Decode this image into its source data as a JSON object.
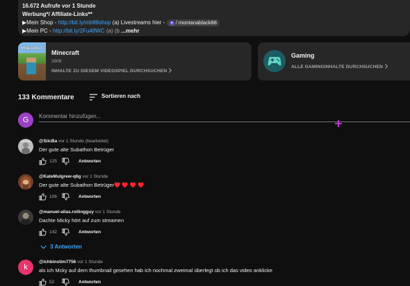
{
  "description": {
    "views_line": "16.672 Aufrufe  vor 1 Stunde",
    "affiliate_line": "Werbung*/ Affiliate-Links**",
    "shop": {
      "prefix": "▶Mein Shop - ",
      "link": "http://bit.ly/mb88shop",
      "middle": " (a) Livestreams hier - ",
      "chip_label": "/ montanablack88"
    },
    "pc": {
      "prefix": "▶Mein PC - ",
      "link": "http://bit.ly/2Fu48WC",
      "middle": " (a) (b",
      "more_label": "...mehr"
    }
  },
  "game_card": {
    "thumb_title": "MINECRAFT",
    "title": "Minecraft",
    "year": "2009",
    "cta": "INHALTE ZU DIESEM VIDEOSPIEL DURCHSUCHEN",
    "cta_icon": "chevron-right-icon"
  },
  "gaming_card": {
    "title": "Gaming",
    "cta": "ALLE GAMINGINHALTE DURCHSUCHEN",
    "icon": "gamepad-icon"
  },
  "comments": {
    "count_label": "133 Kommentare",
    "sort_label": "Sortieren nach",
    "input_placeholder": "Kommentar hinzufügen...",
    "my_avatar_letter": "G",
    "replies_toggle_label": "3 Antworten",
    "items": [
      {
        "author": "@SiicBa",
        "time": "vor 1 Stunde (bearbeitet)",
        "text": "Der gute alte Subathon Betrüger",
        "likes": "125",
        "reply_label": "Antworten"
      },
      {
        "author": "@KateMulgrew-q6g",
        "time": "vor 1 Stunde",
        "text": "Der gute alte Subathon Betrüger♥️ ♥️ ♥️ ♥️",
        "likes": "106",
        "reply_label": "Antworten"
      },
      {
        "author": "@manuel-alias.rollingguy",
        "time": "vor 1 Stunde",
        "text": "Dachte Micky hört auf zum streamen",
        "likes": "142",
        "reply_label": "Antworten"
      },
      {
        "author": "@ichbinstim7756",
        "time": "vor 1 Stunde",
        "text": "als ich Mcky auf dem thumbnail gesehen hab ich nochmal zweimal überlegt ob ich das video anklicke",
        "likes": "52",
        "reply_label": "Antworten",
        "avatar_letter": "k"
      }
    ]
  },
  "colors": {
    "background": "#0f0f0f",
    "card": "#272727",
    "link": "#3ea6ff",
    "my_avatar": "#9c41c5",
    "last_avatar": "#e8336b",
    "cursor": "#e040fb"
  }
}
